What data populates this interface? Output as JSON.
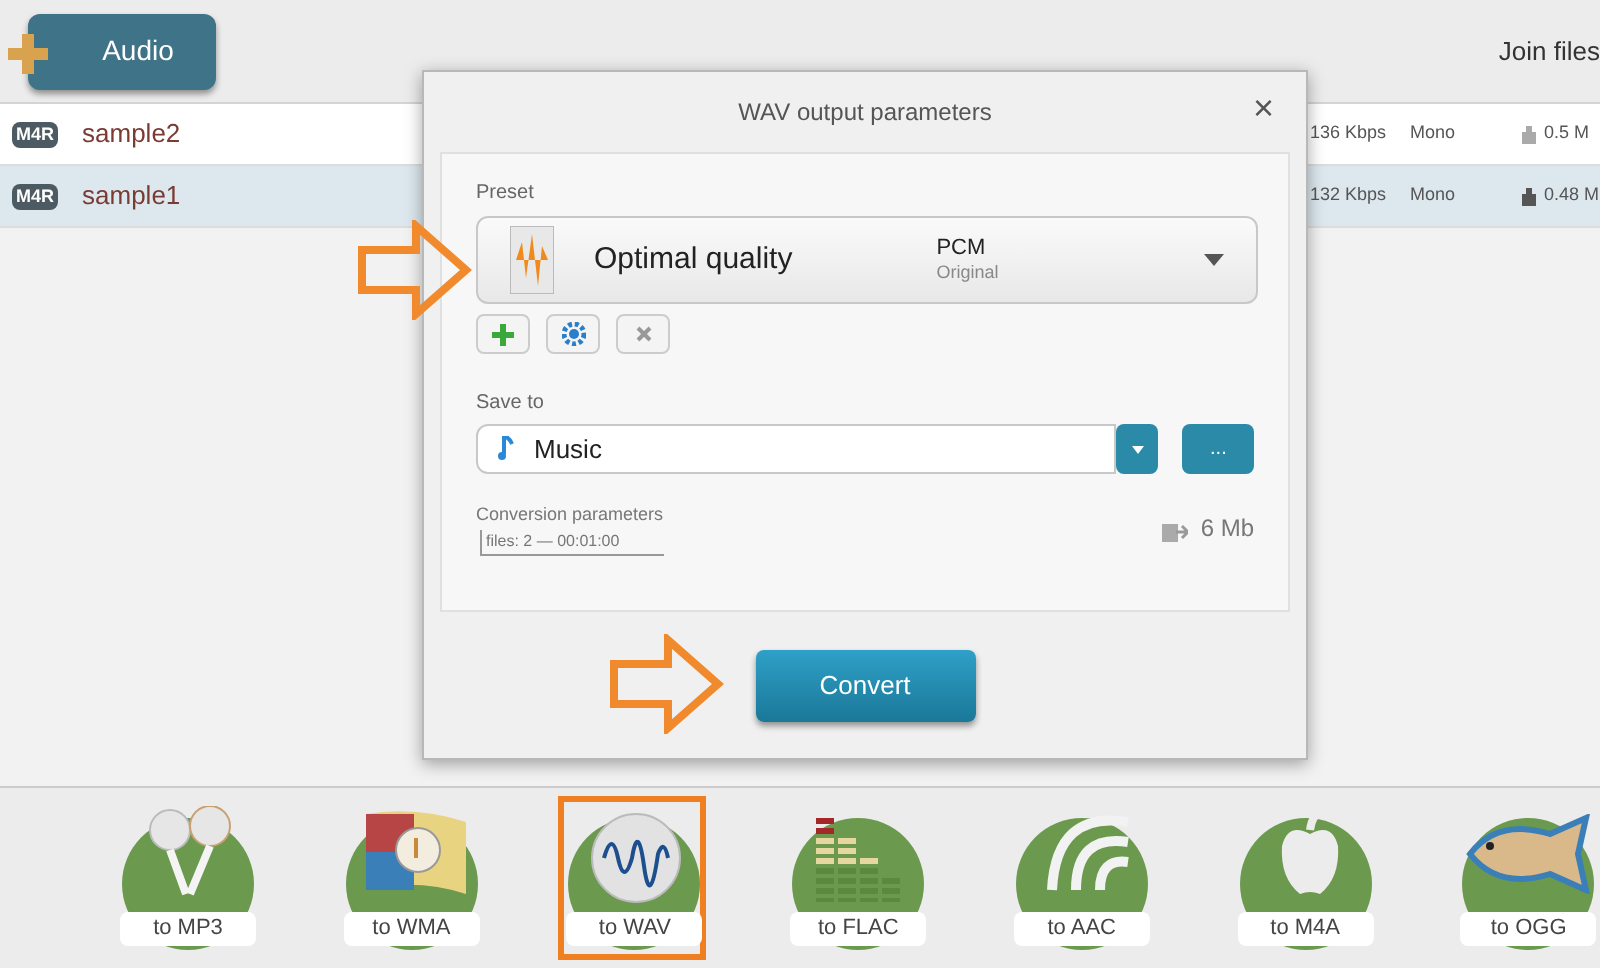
{
  "toolbar": {
    "add_button": "Audio",
    "join_label": "Join files"
  },
  "files": [
    {
      "format": "M4R",
      "name": "sample2",
      "bitrate": "136 Kbps",
      "channels": "Mono",
      "size": "0.5 M",
      "selected": false
    },
    {
      "format": "M4R",
      "name": "sample1",
      "bitrate": "132 Kbps",
      "channels": "Mono",
      "size": "0.48 M",
      "selected": true
    }
  ],
  "dialog": {
    "title": "WAV output parameters",
    "close": "×",
    "preset_label": "Preset",
    "preset": {
      "name": "Optimal quality",
      "codec": "PCM",
      "detail": "Original"
    },
    "save_label": "Save to",
    "save_to": "Music",
    "browse": "...",
    "params_label": "Conversion parameters",
    "params_detail": "files: 2 — 00:01:00",
    "size": "6 Mb",
    "convert": "Convert"
  },
  "formats": [
    {
      "kind": "mp3",
      "label": "to MP3",
      "selected": false
    },
    {
      "kind": "wma",
      "label": "to WMA",
      "selected": false
    },
    {
      "kind": "wav",
      "label": "to WAV",
      "selected": true
    },
    {
      "kind": "flac",
      "label": "to FLAC",
      "selected": false
    },
    {
      "kind": "aac",
      "label": "to AAC",
      "selected": false
    },
    {
      "kind": "m4a",
      "label": "to M4A",
      "selected": false
    },
    {
      "kind": "ogg",
      "label": "to OGG",
      "selected": false
    }
  ]
}
